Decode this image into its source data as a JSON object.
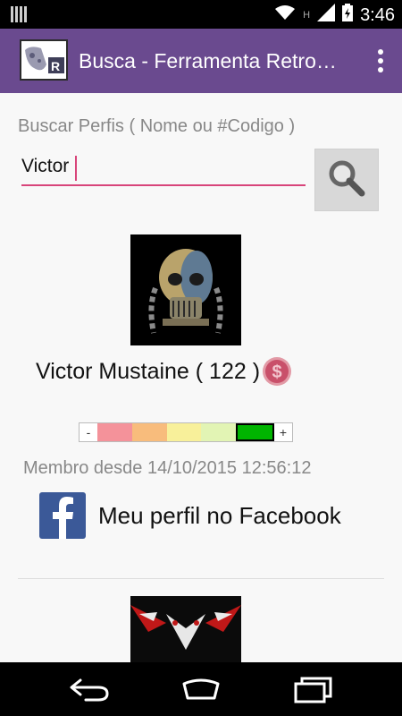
{
  "status_bar": {
    "time": "3:46",
    "icons": [
      "sim-icon",
      "wifi-icon",
      "data-icon",
      "signal-icon",
      "battery-icon"
    ],
    "data_indicator": "H"
  },
  "app_bar": {
    "title": "Busca - Ferramenta Retro…",
    "app_icon": "retro-controller-icon",
    "overflow_icon": "overflow-menu-icon",
    "color": "#6a4a8f"
  },
  "search": {
    "label": "Buscar Perfis ( Nome ou #Codigo )",
    "value": "Victor",
    "accent": "#d8457a",
    "button_icon": "search-icon"
  },
  "results": [
    {
      "name": "Victor Mustaine ( 122 )",
      "badge_icon": "money-icon",
      "member_since": "Membro desde 14/10/2015 12:56:12",
      "facebook_label": "Meu perfil no Facebook",
      "rating": {
        "minus_label": "-",
        "plus_label": "+",
        "segments": [
          "#f4929a",
          "#f8bc7c",
          "#f8f09a",
          "#e2f4b4",
          "#00b400"
        ],
        "selected_index": 4
      }
    }
  ],
  "nav_bar": {
    "icons": [
      "back-icon",
      "home-icon",
      "recents-icon"
    ]
  }
}
